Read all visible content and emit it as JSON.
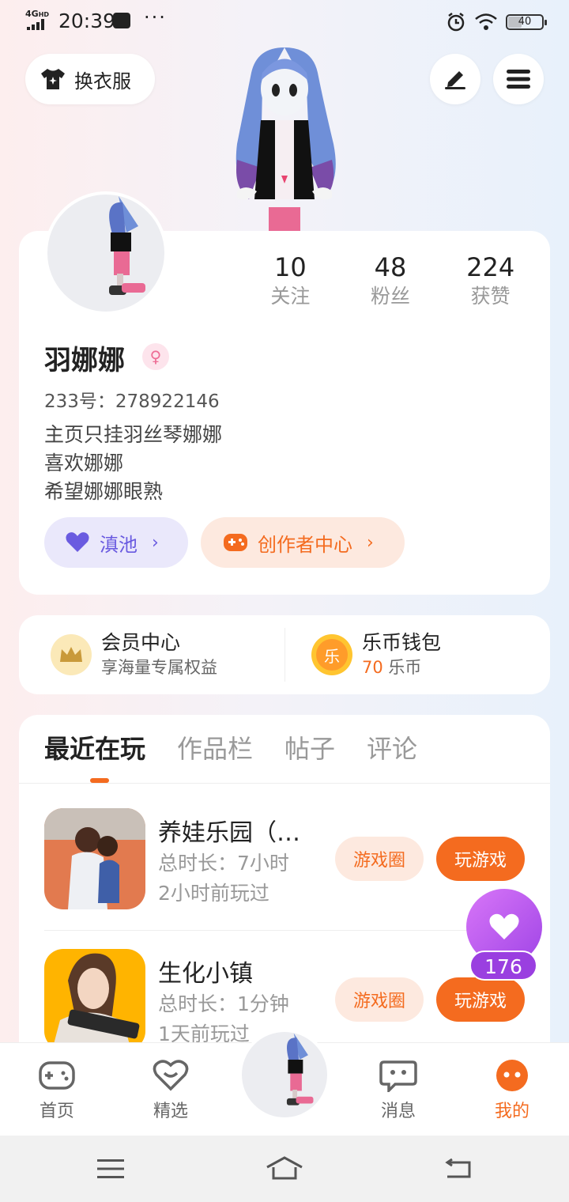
{
  "status_bar": {
    "network": "4G",
    "network_hd": "HD",
    "time": "20:39",
    "dots": "···",
    "battery": "40",
    "battery_level": 0.4
  },
  "header": {
    "outfit_label": "换衣服",
    "outfit_icon": "tshirt-icon",
    "edit_icon": "pen-icon",
    "menu_icon": "hamburger-icon"
  },
  "profile": {
    "stats": [
      {
        "value": "10",
        "label": "关注"
      },
      {
        "value": "48",
        "label": "粉丝"
      },
      {
        "value": "224",
        "label": "获赞"
      }
    ],
    "username": "羽娜娜",
    "gender_icon": "female-icon",
    "uid": "233号：278922146",
    "bio": [
      "主页只挂羽丝琴娜娜",
      "喜欢娜娜",
      "希望娜娜眼熟"
    ],
    "pond_label": "滇池",
    "creator_label": "创作者中心"
  },
  "wallet": {
    "vip_title": "会员中心",
    "vip_sub": "享海量专属权益",
    "coin_title": "乐币钱包",
    "coin_icon_text": "乐",
    "coin_amount": "70",
    "coin_unit": "乐币"
  },
  "tabs": [
    "最近在玩",
    "作品栏",
    "帖子",
    "评论"
  ],
  "games": [
    {
      "title": "养娃乐园（…",
      "duration": "总时长：7小时",
      "last_played": "2小时前玩过",
      "circle_label": "游戏圈",
      "play_label": "玩游戏"
    },
    {
      "title": "生化小镇",
      "duration": "总时长：1分钟",
      "last_played": "1天前玩过",
      "circle_label": "游戏圈",
      "play_label": "玩游戏"
    }
  ],
  "like_count": "176",
  "nav": [
    {
      "label": "首页",
      "icon": "gamepad-icon"
    },
    {
      "label": "精选",
      "icon": "heart-chat-icon"
    },
    {
      "label": "消息",
      "icon": "message-icon"
    },
    {
      "label": "我的",
      "icon": "profile-icon"
    }
  ],
  "colors": {
    "accent": "#f46b1f",
    "purple": "#6a5be0",
    "like": "#a045e6"
  }
}
